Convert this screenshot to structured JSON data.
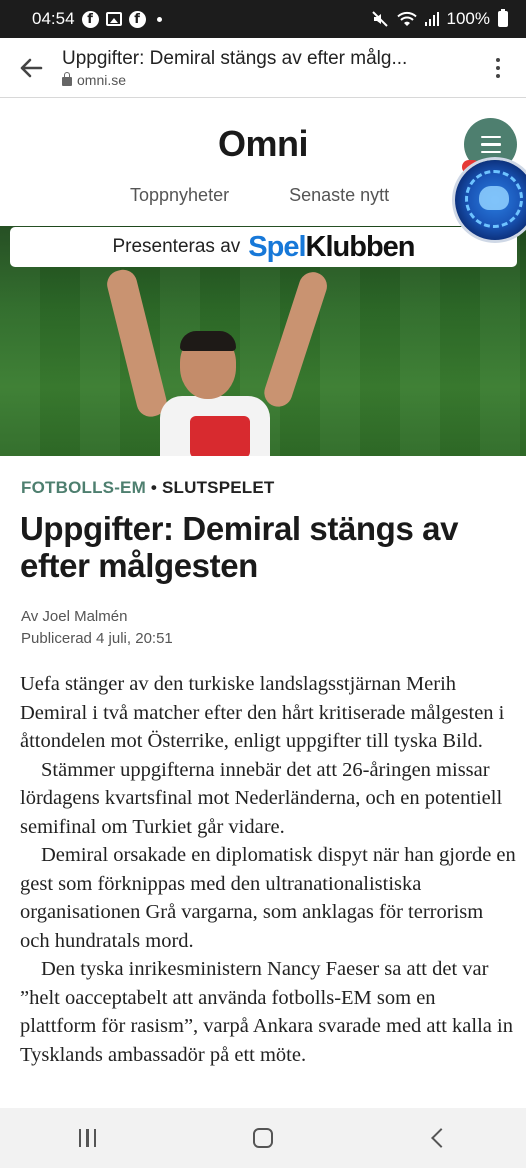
{
  "status_bar": {
    "time": "04:54",
    "battery": "100%",
    "icons": [
      "facebook-icon",
      "gallery-icon",
      "facebook-icon",
      "dot",
      "mute-icon",
      "wifi-icon",
      "signal-icon",
      "battery-icon"
    ]
  },
  "browser": {
    "page_title": "Uppgifter: Demiral stängs av efter målg...",
    "url": "omni.se"
  },
  "site": {
    "logo": "Omni",
    "nav": [
      "Toppnyheter",
      "Senaste nytt"
    ],
    "accent_color": "#4e7f6f"
  },
  "sponsor": {
    "label": "Presenteras av",
    "brand_part1": "Spel",
    "brand_part2": "Klubben"
  },
  "article": {
    "category": "FOTBOLLS-EM",
    "separator": "•",
    "subcategory": "SLUTSPELET",
    "headline": "Uppgifter: Demiral stängs av efter målgesten",
    "author": "Av Joel Malmén",
    "published": "Publicerad 4 juli, 20:51",
    "paragraphs": [
      "Uefa stänger av den turkiske landslagsstjärnan Merih Demiral i två matcher efter den hårt kritiserade målgesten i åttondelen mot Österrike, enligt uppgifter till tyska Bild.",
      "Stämmer uppgifterna innebär det att 26-åringen missar lördagens kvartsfinal mot Nederländerna, och en potentiell semifinal om Turkiet går vidare.",
      "Demiral orsakade en diplomatisk dispyt när han gjorde en gest som förknippas med den ultranationalistiska organisationen Grå vargarna, som anklagas för terrorism och hundratals mord.",
      "Den tyska inrikesministern Nancy Faeser sa att det var ”helt oacceptabelt att använda fotbolls-EM som en plattform för rasism”, varpå Ankara svarade med att kalla in Tysklands ambassadör på ett möte."
    ]
  }
}
